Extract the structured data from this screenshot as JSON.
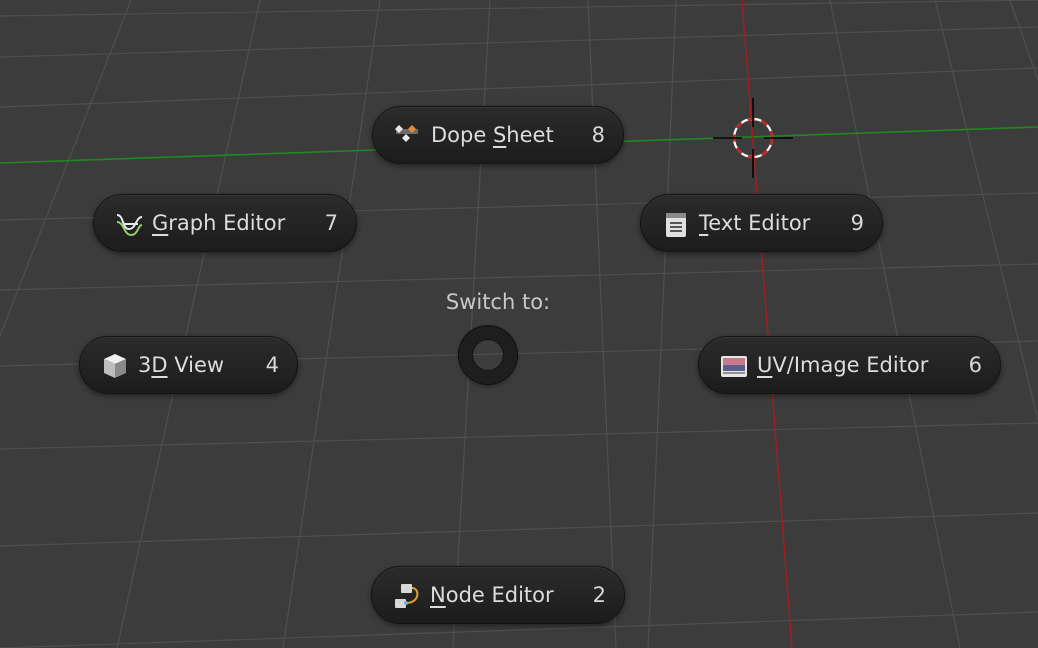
{
  "pie_menu": {
    "title": "Switch to:",
    "items": [
      {
        "pre": "Dope ",
        "ul": "S",
        "post": "heet",
        "key": "8",
        "icon": "dope-sheet-icon"
      },
      {
        "pre": "",
        "ul": "G",
        "post": "raph Editor",
        "key": "7",
        "icon": "graph-editor-icon"
      },
      {
        "pre": "",
        "ul": "T",
        "post": "ext Editor",
        "key": "9",
        "icon": "text-editor-icon"
      },
      {
        "pre": "3",
        "ul": "D",
        "post": " View",
        "key": "4",
        "icon": "cube-icon"
      },
      {
        "pre": "",
        "ul": "U",
        "post": "V/Image Editor",
        "key": "6",
        "icon": "image-editor-icon"
      },
      {
        "pre": "",
        "ul": "N",
        "post": "ode Editor",
        "key": "2",
        "icon": "node-editor-icon"
      }
    ]
  },
  "colors": {
    "background": "#3c3c3c",
    "grid": "#4e4e4e",
    "x_axis": "#1f8a1f",
    "y_axis": "#9c2020"
  }
}
